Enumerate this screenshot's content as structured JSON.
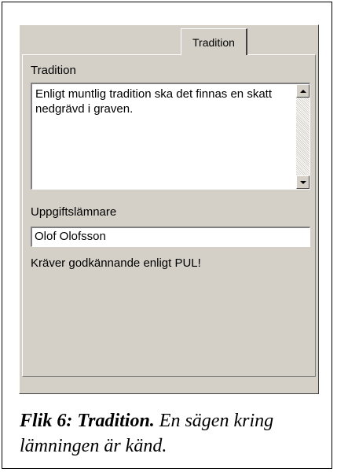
{
  "tab": {
    "label": "Tradition"
  },
  "tradition": {
    "label": "Tradition",
    "text": "Enligt muntlig tradition ska det finnas en skatt nedgrävd i graven."
  },
  "informant": {
    "label": "Uppgiftslämnare",
    "value": "Olof Olofsson"
  },
  "notice": "Kräver godkännande enligt PUL!",
  "caption": {
    "bold": "Flik 6: Tradition.",
    "rest": " En sägen kring lämningen är känd."
  }
}
